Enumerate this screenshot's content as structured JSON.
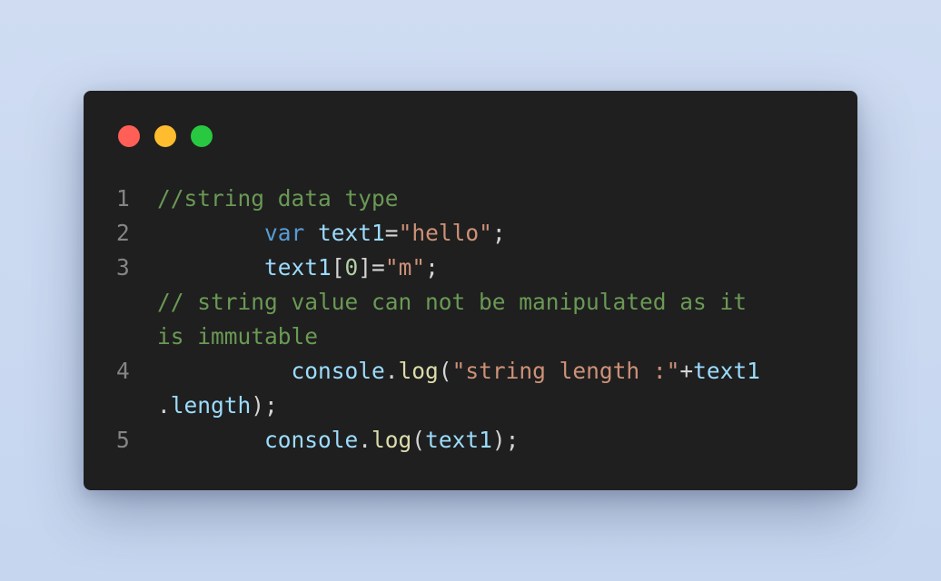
{
  "window": {
    "controls": [
      {
        "name": "close",
        "color": "#ff5f57"
      },
      {
        "name": "minimize",
        "color": "#febc2e"
      },
      {
        "name": "maximize",
        "color": "#28c840"
      }
    ]
  },
  "code": {
    "lines": [
      {
        "number": "1",
        "segments": [
          {
            "text": "//string data type",
            "type": "comment"
          }
        ]
      },
      {
        "number": "2",
        "segments": [
          {
            "text": "        var",
            "type": "kw"
          },
          {
            "text": " ",
            "type": "plain"
          },
          {
            "text": "text1",
            "type": "var"
          },
          {
            "text": "=",
            "type": "plain"
          },
          {
            "text": "\"hello\"",
            "type": "str"
          },
          {
            "text": ";",
            "type": "plain"
          }
        ]
      },
      {
        "number": "3",
        "segments": [
          {
            "text": "        text1",
            "type": "var"
          },
          {
            "text": "[",
            "type": "plain"
          },
          {
            "text": "0",
            "type": "num"
          },
          {
            "text": "]=",
            "type": "plain"
          },
          {
            "text": "\"m\"",
            "type": "str"
          },
          {
            "text": ";",
            "type": "plain"
          }
        ]
      },
      {
        "number": "",
        "segments": [
          {
            "text": "// string value can not be manipulated as it",
            "type": "comment"
          }
        ]
      },
      {
        "number": "",
        "segments": [
          {
            "text": "is immutable",
            "type": "comment"
          }
        ]
      },
      {
        "number": "4",
        "segments": [
          {
            "text": "          console",
            "type": "var"
          },
          {
            "text": ".",
            "type": "plain"
          },
          {
            "text": "log",
            "type": "fn"
          },
          {
            "text": "(",
            "type": "plain"
          },
          {
            "text": "\"string length :\"",
            "type": "str"
          },
          {
            "text": "+",
            "type": "plain"
          },
          {
            "text": "text1",
            "type": "var"
          }
        ]
      },
      {
        "number": "",
        "segments": [
          {
            "text": ".",
            "type": "plain"
          },
          {
            "text": "length",
            "type": "var"
          },
          {
            "text": ");",
            "type": "plain"
          }
        ]
      },
      {
        "number": "5",
        "segments": [
          {
            "text": "        console",
            "type": "var"
          },
          {
            "text": ".",
            "type": "plain"
          },
          {
            "text": "log",
            "type": "fn"
          },
          {
            "text": "(",
            "type": "plain"
          },
          {
            "text": "text1",
            "type": "var"
          },
          {
            "text": ");",
            "type": "plain"
          }
        ]
      }
    ]
  }
}
